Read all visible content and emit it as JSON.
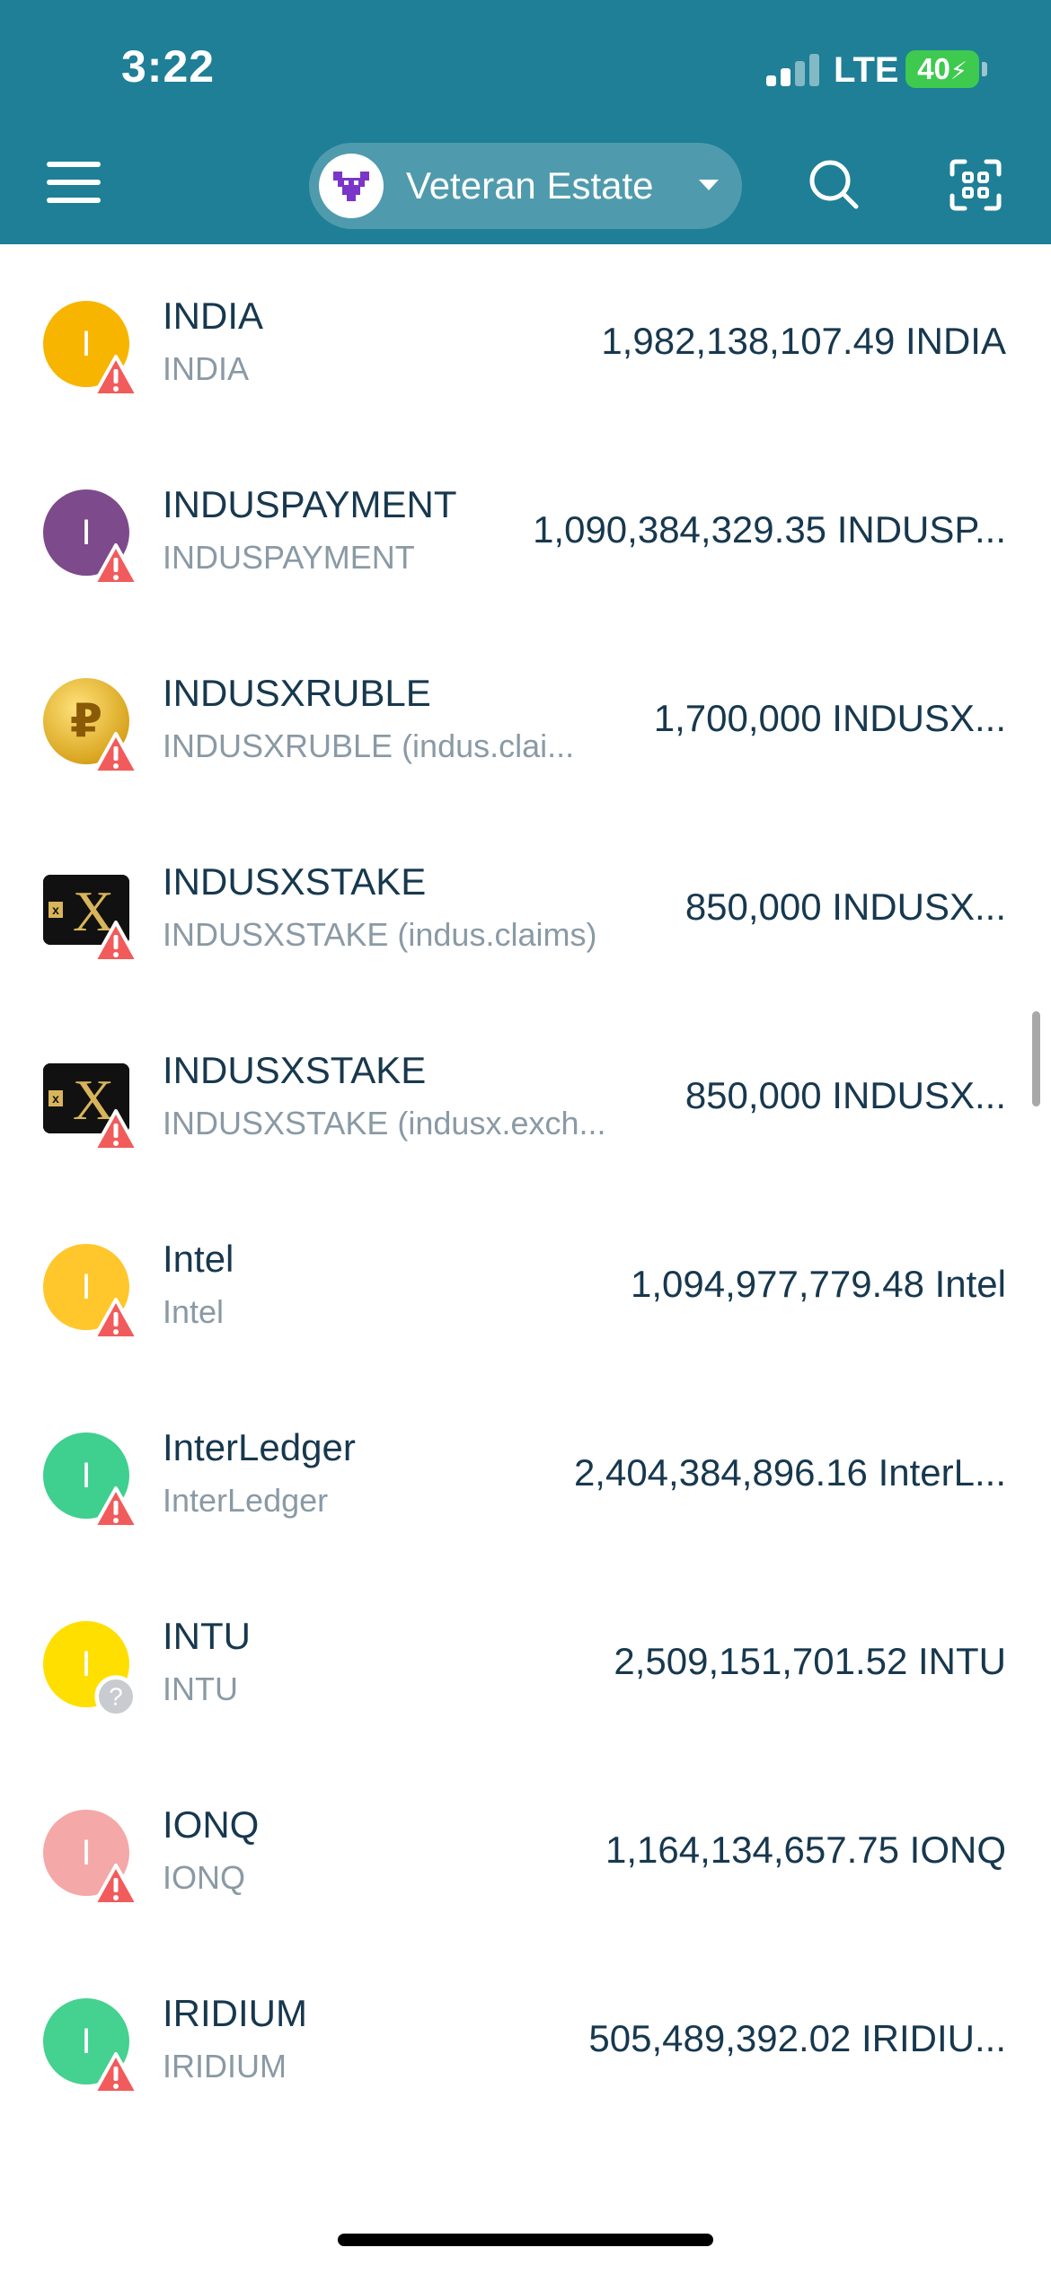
{
  "status_bar": {
    "time": "3:22",
    "network": "LTE",
    "battery": "40"
  },
  "header": {
    "account_name": "Veteran Estate",
    "menu_icon": "hamburger-menu-icon",
    "search_icon": "search-icon",
    "scan_icon": "scan-qr-icon"
  },
  "colors": {
    "header_bg": "#1e7f96",
    "primary_text": "#17384e",
    "secondary_text": "#8a9aa5",
    "warning_red": "#f25b5b",
    "unknown_gray": "#c8cbd0"
  },
  "assets": [
    {
      "icon_letter": "I",
      "icon_color": "#f7b500",
      "icon_type": "letter",
      "badge": "warning",
      "name": "INDIA",
      "subtitle": "INDIA",
      "amount": "1,982,138,107.49 INDIA"
    },
    {
      "icon_letter": "I",
      "icon_color": "#7d4a8c",
      "icon_type": "letter",
      "badge": "warning",
      "name": "INDUSPAYMENT",
      "subtitle": "INDUSPAYMENT",
      "amount": "1,090,384,329.35 INDUSP..."
    },
    {
      "icon_letter": "₽",
      "icon_color": "#d9a51f",
      "icon_type": "ruble-coin",
      "badge": "warning",
      "name": "INDUSXRUBLE",
      "subtitle": "INDUSXRUBLE (indus.clai...",
      "amount": "1,700,000 INDUSX..."
    },
    {
      "icon_letter": "X",
      "icon_color": "#111111",
      "icon_type": "x-logo",
      "badge": "warning",
      "name": "INDUSXSTAKE",
      "subtitle": "INDUSXSTAKE (indus.claims)",
      "amount": "850,000 INDUSX..."
    },
    {
      "icon_letter": "X",
      "icon_color": "#111111",
      "icon_type": "x-logo",
      "badge": "warning",
      "name": "INDUSXSTAKE",
      "subtitle": "INDUSXSTAKE (indusx.exch...",
      "amount": "850,000 INDUSX..."
    },
    {
      "icon_letter": "I",
      "icon_color": "#ffc72c",
      "icon_type": "letter",
      "badge": "warning",
      "name": "Intel",
      "subtitle": "Intel",
      "amount": "1,094,977,779.48 Intel"
    },
    {
      "icon_letter": "I",
      "icon_color": "#3fcf8e",
      "icon_type": "letter",
      "badge": "warning",
      "name": "InterLedger",
      "subtitle": "InterLedger",
      "amount": "2,404,384,896.16 InterL..."
    },
    {
      "icon_letter": "I",
      "icon_color": "#ffdf00",
      "icon_type": "letter",
      "badge": "unknown",
      "name": "INTU",
      "subtitle": "INTU",
      "amount": "2,509,151,701.52 INTU"
    },
    {
      "icon_letter": "I",
      "icon_color": "#f4a8a8",
      "icon_type": "letter",
      "badge": "warning",
      "name": "IONQ",
      "subtitle": "IONQ",
      "amount": "1,164,134,657.75 IONQ"
    },
    {
      "icon_letter": "I",
      "icon_color": "#45d18f",
      "icon_type": "letter",
      "badge": "warning",
      "name": "IRIDIUM",
      "subtitle": "IRIDIUM",
      "amount": "505,489,392.02 IRIDIU..."
    }
  ]
}
